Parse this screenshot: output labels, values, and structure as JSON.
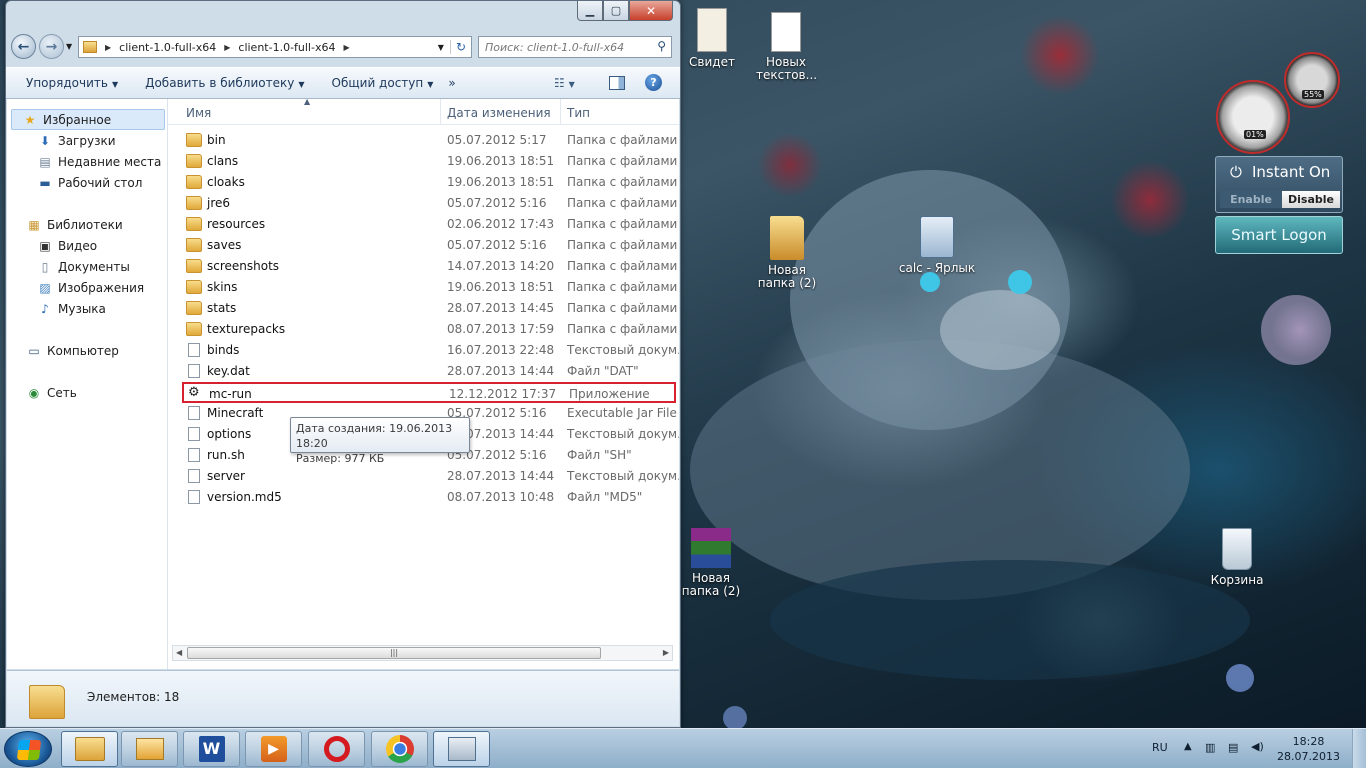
{
  "explorer": {
    "address": [
      "client-1.0-full-x64",
      "client-1.0-full-x64"
    ],
    "search_placeholder": "Поиск: client-1.0-full-x64",
    "toolbar": {
      "organize": "Упорядочить",
      "add_library": "Добавить в библиотеку",
      "share": "Общий доступ",
      "more": "»"
    },
    "nav": {
      "favorites": "Избранное",
      "downloads": "Загрузки",
      "recent": "Недавние места",
      "desktop": "Рабочий стол",
      "libraries": "Библиотеки",
      "video": "Видео",
      "documents": "Документы",
      "images": "Изображения",
      "music": "Музыка",
      "computer": "Компьютер",
      "network": "Сеть"
    },
    "columns": {
      "name": "Имя",
      "date": "Дата изменения",
      "type": "Тип"
    },
    "files": [
      {
        "name": "bin",
        "date": "05.07.2012 5:17",
        "type": "Папка с файлами",
        "kind": "folder"
      },
      {
        "name": "clans",
        "date": "19.06.2013 18:51",
        "type": "Папка с файлами",
        "kind": "folder"
      },
      {
        "name": "cloaks",
        "date": "19.06.2013 18:51",
        "type": "Папка с файлами",
        "kind": "folder"
      },
      {
        "name": "jre6",
        "date": "05.07.2012 5:16",
        "type": "Папка с файлами",
        "kind": "folder"
      },
      {
        "name": "resources",
        "date": "02.06.2012 17:43",
        "type": "Папка с файлами",
        "kind": "folder"
      },
      {
        "name": "saves",
        "date": "05.07.2012 5:16",
        "type": "Папка с файлами",
        "kind": "folder"
      },
      {
        "name": "screenshots",
        "date": "14.07.2013 14:20",
        "type": "Папка с файлами",
        "kind": "folder"
      },
      {
        "name": "skins",
        "date": "19.06.2013 18:51",
        "type": "Папка с файлами",
        "kind": "folder"
      },
      {
        "name": "stats",
        "date": "28.07.2013 14:45",
        "type": "Папка с файлами",
        "kind": "folder"
      },
      {
        "name": "texturepacks",
        "date": "08.07.2013 17:59",
        "type": "Папка с файлами",
        "kind": "folder"
      },
      {
        "name": "binds",
        "date": "16.07.2013 22:48",
        "type": "Текстовый докум...",
        "kind": "doc"
      },
      {
        "name": "key.dat",
        "date": "28.07.2013 14:44",
        "type": "Файл \"DAT\"",
        "kind": "doc"
      },
      {
        "name": "mc-run",
        "date": "12.12.2012 17:37",
        "type": "Приложение",
        "kind": "app"
      },
      {
        "name": "Minecraft",
        "date": "05.07.2012 5:16",
        "type": "Executable Jar File",
        "kind": "doc"
      },
      {
        "name": "options",
        "date": "28.07.2013 14:44",
        "type": "Текстовый докум...",
        "kind": "doc"
      },
      {
        "name": "run.sh",
        "date": "05.07.2012 5:16",
        "type": "Файл \"SH\"",
        "kind": "doc"
      },
      {
        "name": "server",
        "date": "28.07.2013 14:44",
        "type": "Текстовый докум...",
        "kind": "doc"
      },
      {
        "name": "version.md5",
        "date": "08.07.2013 10:48",
        "type": "Файл \"MD5\"",
        "kind": "doc"
      }
    ],
    "tooltip": {
      "created": "Дата создания: 19.06.2013 18:20",
      "size": "Размер: 977 КБ"
    },
    "status": "Элементов: 18"
  },
  "desktop": {
    "icons": {
      "cert": "Свидет",
      "newtext": "Новых текстов...",
      "folder1": "Новая папка (2)",
      "calc": "calc - Ярлык",
      "rar": "Новая папка (2)",
      "recycle": "Корзина"
    },
    "gadget": {
      "cpu": "01%",
      "mem": "55%"
    },
    "instant_on": {
      "title": "Instant On",
      "enable": "Enable",
      "disable": "Disable"
    },
    "smart_logon": "Smart Logon"
  },
  "taskbar": {
    "lang": "RU",
    "time": "18:28",
    "date": "28.07.2013"
  }
}
